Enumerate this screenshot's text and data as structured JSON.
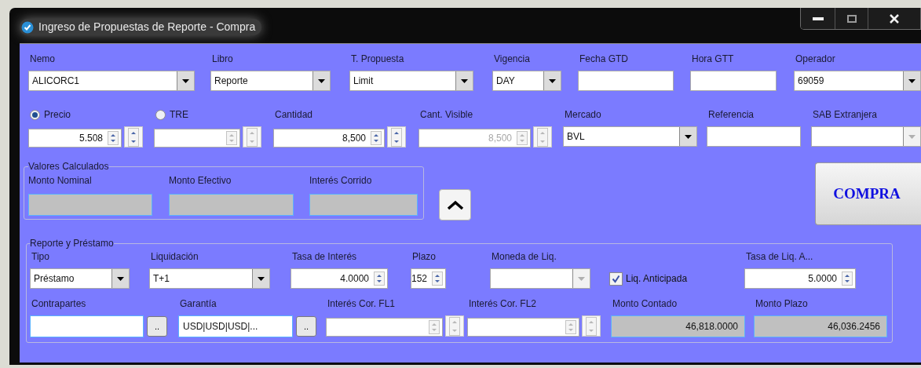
{
  "window": {
    "title": "Ingreso de Propuestas de Reporte - Compra"
  },
  "order_fields": [
    {
      "label": "Nemo",
      "kind": "combo",
      "value": "ALICORC1",
      "disabled": false
    },
    {
      "label": "Libro",
      "kind": "combo",
      "value": "Reporte",
      "disabled": false
    },
    {
      "label": "T. Propuesta",
      "kind": "combo",
      "value": "Limit",
      "disabled": false
    },
    {
      "label": "Vigencia",
      "kind": "combo",
      "value": "DAY",
      "disabled": false
    },
    {
      "label": "Fecha GTD",
      "kind": "text",
      "disabled": false
    },
    {
      "label": "Hora GTT",
      "kind": "text",
      "disabled": false
    },
    {
      "label": "Operador",
      "kind": "combo",
      "value": "69059",
      "disabled": false
    }
  ],
  "quantity_fields": [
    {
      "label": "Precio",
      "kind": "spin-double",
      "value": "5.508",
      "selected": true,
      "disabled": false
    },
    {
      "label": "TRE",
      "kind": "spin-double",
      "selected": false,
      "disabled": true
    },
    {
      "label": "Cantidad",
      "kind": "spin-double",
      "value": "8,500",
      "disabled": false
    },
    {
      "label": "Cant. Visible",
      "kind": "spin-double",
      "value": "8,500",
      "disabled": true
    },
    {
      "label": "Mercado",
      "kind": "combo",
      "value": "BVL",
      "disabled": false
    },
    {
      "label": "Referencia",
      "kind": "text",
      "disabled": false
    },
    {
      "label": "SAB Extranjera",
      "kind": "combo",
      "disabled": true
    }
  ],
  "calculated": {
    "title": "Valores Calculados",
    "fields": [
      {
        "label": "Monto Nominal",
        "kind": "readonly"
      },
      {
        "label": "Monto Efectivo",
        "kind": "readonly"
      },
      {
        "label": "Interés Corrido",
        "kind": "readonly"
      }
    ]
  },
  "submit_button": {
    "label": "COMPRA"
  },
  "report": {
    "title": "Reporte y Préstamo",
    "settlement_fields": [
      {
        "label": "Tipo",
        "kind": "combo",
        "value": "Préstamo",
        "disabled": false
      },
      {
        "label": "Liquidación",
        "kind": "combo",
        "value": "T+1",
        "disabled": false
      },
      {
        "label": "Tasa de Interés",
        "kind": "spin",
        "value": "4.0000",
        "disabled": false
      },
      {
        "label": "Plazo",
        "kind": "spin",
        "value": "152",
        "disabled": false
      },
      {
        "label": "Moneda de Liq.",
        "kind": "combo",
        "disabled": true
      },
      {
        "label": "Liq. Anticipada",
        "kind": "checkbox",
        "checked": true,
        "disabled": false
      },
      {
        "label": "Tasa de Liq. A...",
        "kind": "spin",
        "value": "5.0000",
        "disabled": false
      }
    ],
    "amount_fields": [
      {
        "label": "Contrapartes",
        "kind": "browse",
        "button": "..",
        "disabled": false
      },
      {
        "label": "Garantía",
        "kind": "browse",
        "value": "USD|USD|USD|...",
        "button": "..",
        "disabled": false
      },
      {
        "label": "Interés Cor. FL1",
        "kind": "spin-double",
        "disabled": true
      },
      {
        "label": "Interés Cor. FL2",
        "kind": "spin-double",
        "disabled": true
      },
      {
        "label": "Monto Contado",
        "kind": "readonly",
        "value": "46,818.0000",
        "disabled": false
      },
      {
        "label": "Monto Plazo",
        "kind": "readonly",
        "value": "46,036.2456",
        "disabled": false
      }
    ]
  }
}
